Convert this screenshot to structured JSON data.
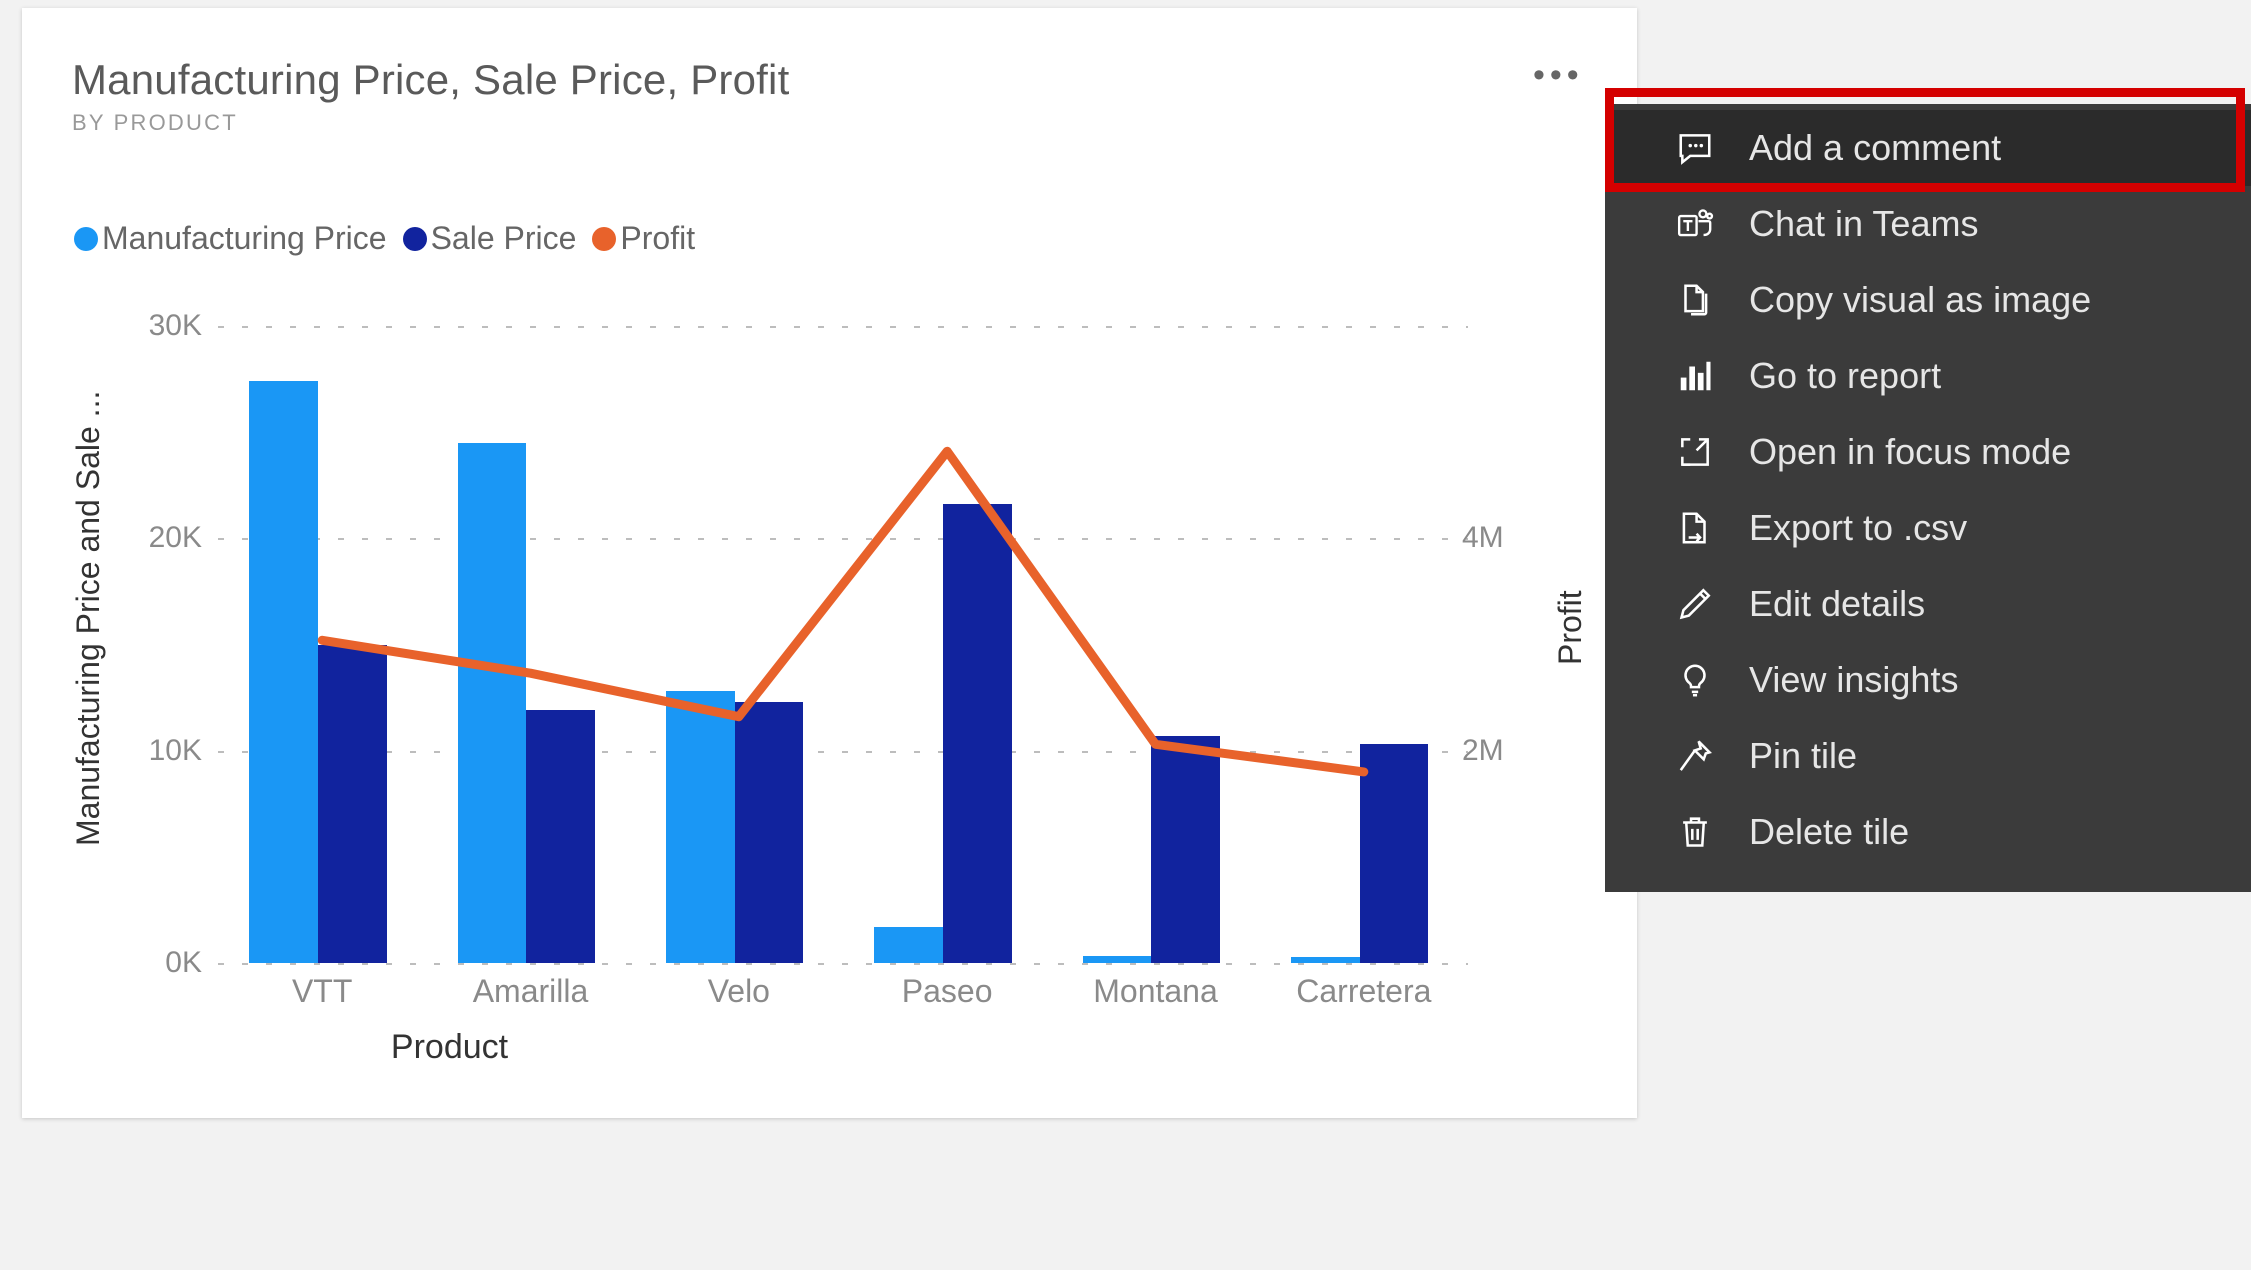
{
  "tile": {
    "title": "Manufacturing Price, Sale Price, Profit",
    "subtitle": "BY PRODUCT",
    "more_options_label": "•••"
  },
  "chart_data": {
    "type": "bar",
    "title": "Manufacturing Price, Sale Price, Profit",
    "subtitle": "BY PRODUCT",
    "xlabel": "Product",
    "ylabel": "Manufacturing Price and Sale ...",
    "y2label": "Profit",
    "categories": [
      "VTT",
      "Amarilla",
      "Velo",
      "Paseo",
      "Montana",
      "Carretera"
    ],
    "ylim": [
      0,
      30000
    ],
    "y_ticks": [
      "0K",
      "10K",
      "20K",
      "30K"
    ],
    "y_tick_values": [
      0,
      10000,
      20000,
      30000
    ],
    "y2lim": [
      0,
      6000000
    ],
    "y2_ticks": [
      "2M",
      "4M"
    ],
    "y2_tick_values": [
      2000000,
      4000000
    ],
    "grid": true,
    "legend_position": "top-left",
    "series": [
      {
        "name": "Manufacturing Price",
        "type": "bar",
        "color": "#1a97f5",
        "axis": "left",
        "values": [
          27400,
          24500,
          12800,
          1700,
          350,
          300
        ]
      },
      {
        "name": "Sale Price",
        "type": "bar",
        "color": "#11239e",
        "axis": "left",
        "values": [
          15000,
          11900,
          12300,
          21600,
          10700,
          10300
        ]
      },
      {
        "name": "Profit",
        "type": "line",
        "color": "#e8622b",
        "axis": "right",
        "values": [
          3040000,
          2730000,
          2320000,
          4820000,
          2060000,
          1800000
        ]
      }
    ]
  },
  "legend": [
    {
      "label": "Manufacturing Price",
      "color": "#1a97f5"
    },
    {
      "label": "Sale Price",
      "color": "#11239e"
    },
    {
      "label": "Profit",
      "color": "#e8622b"
    }
  ],
  "context_menu": {
    "highlighted_index": 0,
    "highlight_color": "#d40000",
    "items": [
      {
        "label": "Add a comment",
        "icon": "comment-icon"
      },
      {
        "label": "Chat in Teams",
        "icon": "teams-icon"
      },
      {
        "label": "Copy visual as image",
        "icon": "copy-icon"
      },
      {
        "label": "Go to report",
        "icon": "bar-chart-icon"
      },
      {
        "label": "Open in focus mode",
        "icon": "focus-mode-icon"
      },
      {
        "label": "Export to .csv",
        "icon": "export-file-icon"
      },
      {
        "label": "Edit details",
        "icon": "pencil-icon"
      },
      {
        "label": "View insights",
        "icon": "lightbulb-icon"
      },
      {
        "label": "Pin tile",
        "icon": "pin-icon"
      },
      {
        "label": "Delete tile",
        "icon": "trash-icon"
      }
    ]
  }
}
